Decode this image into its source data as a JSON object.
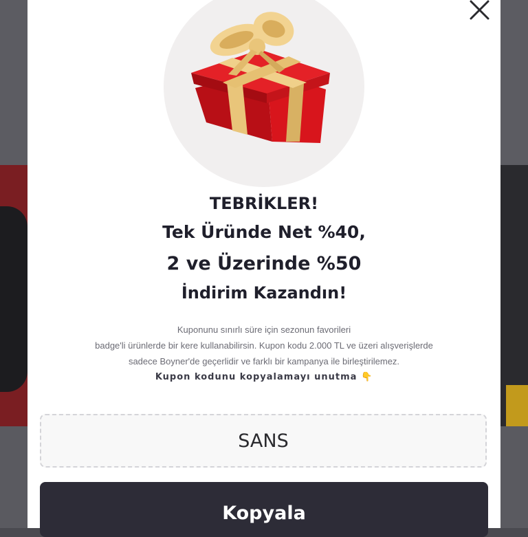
{
  "modal": {
    "close_icon": "close-icon",
    "gift_icon": "gift-box-icon",
    "headline": {
      "line1": "TEBRİKLER!",
      "line2": "Tek Üründe Net %40,",
      "line3": "2 ve Üzerinde %50",
      "line4": "İndirim Kazandın!"
    },
    "description": {
      "line1": "Kuponunu sınırlı süre için sezonun favorileri",
      "line2": "badge'li ürünlerde bir kere kullanabilirsin. Kupon kodu 2.000 TL ve üzeri alışverişlerde",
      "line3": "sadece Boyner'de geçerlidir ve farklı bir kampanya ile birleştirilemez.",
      "reminder": "Kupon kodunu kopyalamayı unutma",
      "reminder_emoji": "👇"
    },
    "coupon_code": "SANS",
    "copy_button_label": "Kopyala",
    "colors": {
      "button_bg": "#2d2c37",
      "heading": "#1f1f2b",
      "gift_red": "#d8151c",
      "gift_ribbon": "#e9c57a"
    }
  }
}
